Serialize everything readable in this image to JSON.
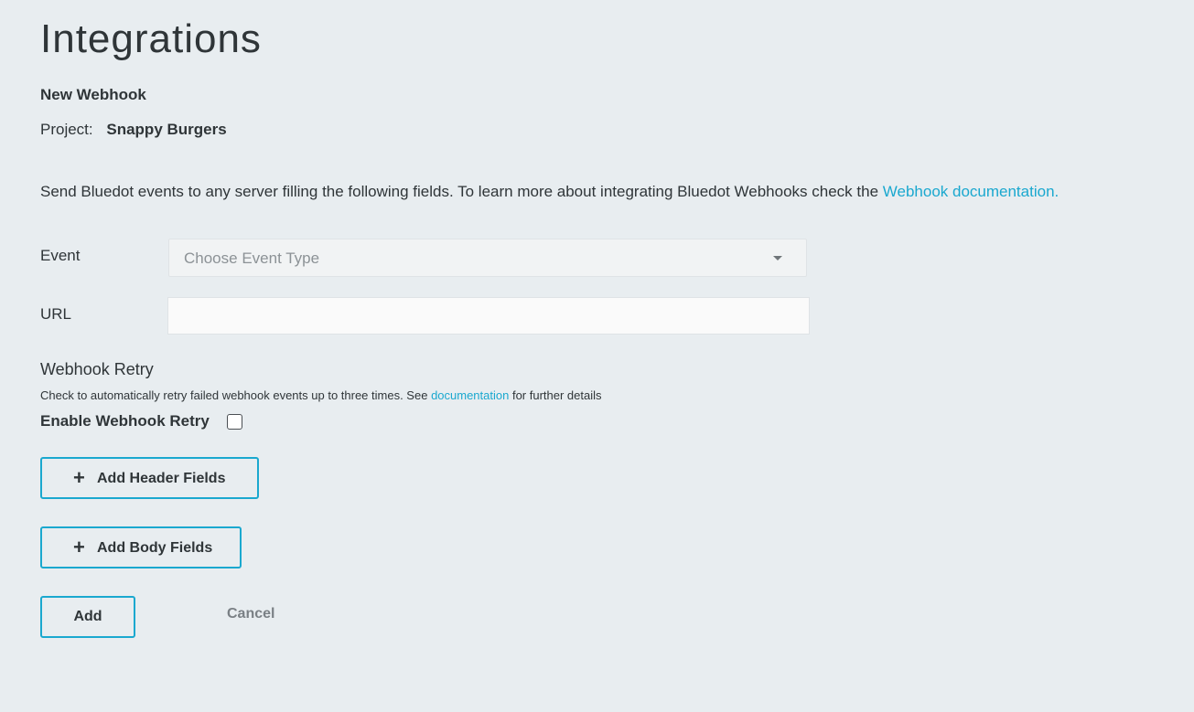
{
  "page": {
    "title": "Integrations",
    "subtitle": "New Webhook",
    "project_label": "Project:",
    "project_name": "Snappy Burgers"
  },
  "description": {
    "text": "Send Bluedot events to any server filling the following fields. To learn more about integrating Bluedot Webhooks check the ",
    "link": "Webhook documentation."
  },
  "form": {
    "event_label": "Event",
    "event_placeholder": "Choose Event Type",
    "url_label": "URL",
    "url_value": ""
  },
  "retry": {
    "heading": "Webhook Retry",
    "help_text": "Check to automatically retry failed webhook events up to three times. See ",
    "help_link": "documentation",
    "help_suffix": " for further details",
    "toggle_label": "Enable Webhook Retry",
    "checked": false
  },
  "actions": {
    "add_header_fields": "Add Header Fields",
    "add_body_fields": "Add Body Fields",
    "add": "Add",
    "cancel": "Cancel"
  },
  "icons": {
    "plus": "plus-icon",
    "dropdown": "caret-down-icon"
  },
  "colors": {
    "background": "#e8edf0",
    "accent": "#1aa8cf",
    "text": "#2f3538",
    "muted": "#7a8085"
  }
}
